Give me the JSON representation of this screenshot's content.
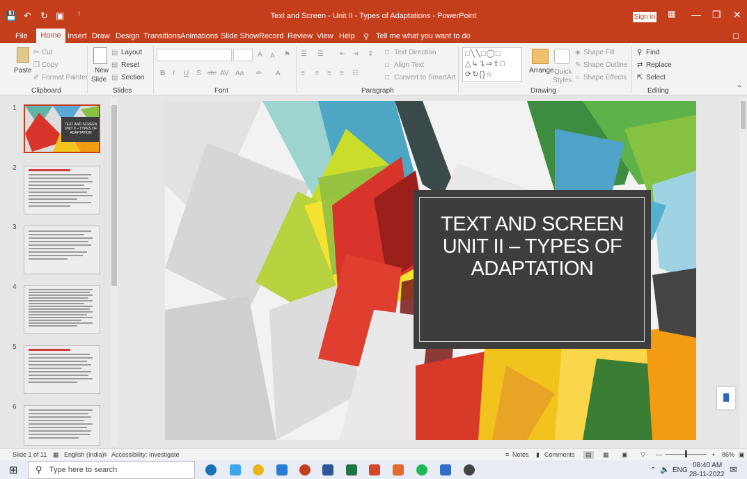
{
  "window": {
    "title": "Text and Screen - Unit II - Types of Adaptations  -  PowerPoint",
    "sign_in": "Sign in"
  },
  "tabs": [
    "File",
    "Home",
    "Insert",
    "Draw",
    "Design",
    "Transitions",
    "Animations",
    "Slide Show",
    "Record",
    "Review",
    "View",
    "Help"
  ],
  "tell_me": "Tell me what you want to do",
  "ribbon": {
    "clipboard": {
      "paste": "Paste",
      "cut": "Cut",
      "copy": "Copy",
      "format_painter": "Format Painter",
      "group": "Clipboard"
    },
    "slides": {
      "new_slide": "New",
      "new_slide2": "Slide",
      "layout": "Layout",
      "reset": "Reset",
      "section": "Section",
      "group": "Slides"
    },
    "font": {
      "group": "Font",
      "bold": "B",
      "italic": "I",
      "underline": "U",
      "strike": "S",
      "aa": "Aa",
      "grow": "A",
      "shrink": "A"
    },
    "paragraph": {
      "text_direction": "Text Direction",
      "align_text": "Align Text",
      "convert": "Convert to SmartArt",
      "group": "Paragraph"
    },
    "drawing": {
      "arrange": "Arrange",
      "quick_styles": "Quick",
      "quick_styles2": "Styles",
      "shape_fill": "Shape Fill",
      "shape_outline": "Shape Outline",
      "shape_effects": "Shape Effects",
      "group": "Drawing"
    },
    "editing": {
      "find": "Find",
      "replace": "Replace",
      "select": "Select",
      "group": "Editing"
    }
  },
  "thumbnails": [
    {
      "num": "1",
      "title_lines": "TEXT AND SCREEN UNIT II – TYPES OF ADAPTATION"
    },
    {
      "num": "2"
    },
    {
      "num": "3"
    },
    {
      "num": "4"
    },
    {
      "num": "5"
    },
    {
      "num": "6"
    }
  ],
  "slide": {
    "title": "TEXT AND SCREEN\nUNIT II – TYPES OF\nADAPTATION"
  },
  "status": {
    "slide_of": "Slide 1 of 11",
    "language": "English (India)",
    "accessibility": "Accessibility: Investigate",
    "notes": "Notes",
    "comments": "Comments",
    "zoom": "86%"
  },
  "taskbar": {
    "search_placeholder": "Type here to search",
    "lang": "ENG",
    "time": "08:40 AM",
    "date": "28-11-2022"
  },
  "colors": {
    "accent": "#c43e1c"
  }
}
